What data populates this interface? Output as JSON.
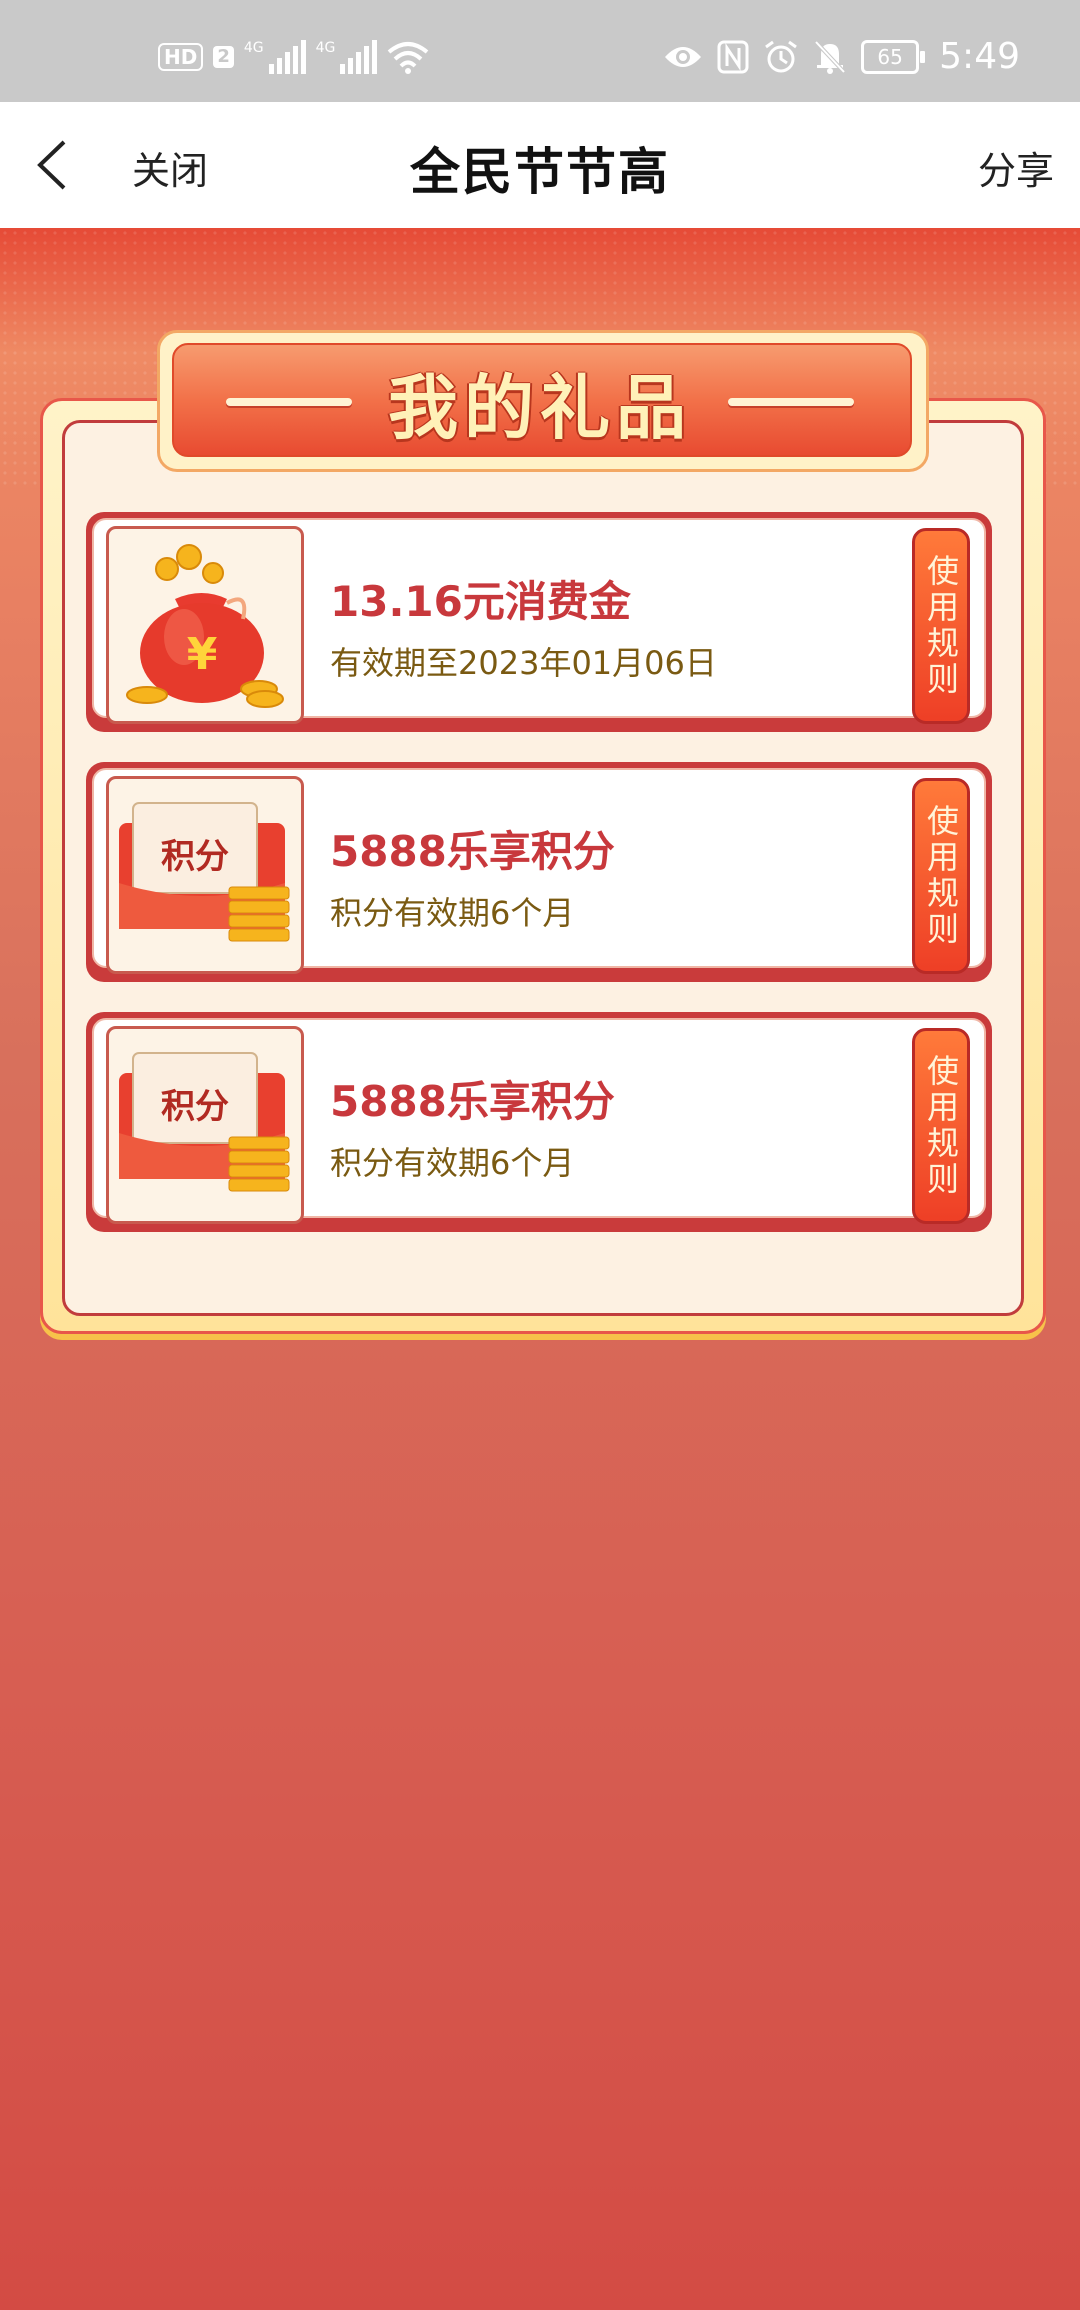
{
  "status_bar": {
    "hd_badge": "HD",
    "sim_badge": "2",
    "network1": "4G",
    "network2": "4G",
    "battery": "65",
    "time": "5:49"
  },
  "nav": {
    "close_label": "关闭",
    "title": "全民节节高",
    "share_label": "分享"
  },
  "panel": {
    "title": "我的礼品"
  },
  "gifts": [
    {
      "name": "13.16元消费金",
      "desc": "有效期至2023年01月06日",
      "rules_label": "使用规则",
      "icon": "money-bag-icon"
    },
    {
      "name": "5888乐享积分",
      "desc": "积分有效期6个月",
      "rules_label": "使用规则",
      "icon": "points-envelope-icon",
      "icon_text": "积分"
    },
    {
      "name": "5888乐享积分",
      "desc": "积分有效期6个月",
      "rules_label": "使用规则",
      "icon": "points-envelope-icon",
      "icon_text": "积分"
    }
  ],
  "colors": {
    "accent_red": "#c8383c",
    "desc_brown": "#7a5a12",
    "status_bar": "#c9c9c9"
  }
}
